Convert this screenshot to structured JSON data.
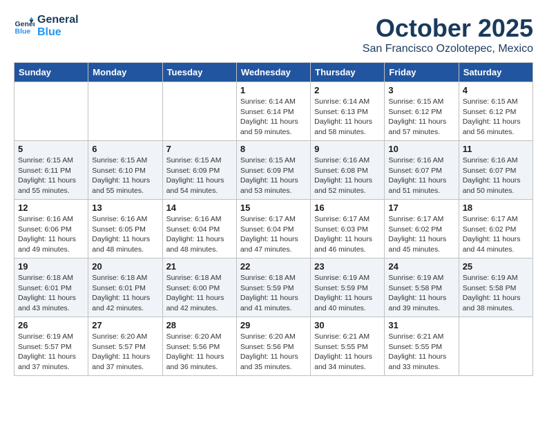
{
  "header": {
    "logo_line1": "General",
    "logo_line2": "Blue",
    "month": "October 2025",
    "location": "San Francisco Ozolotepec, Mexico"
  },
  "weekdays": [
    "Sunday",
    "Monday",
    "Tuesday",
    "Wednesday",
    "Thursday",
    "Friday",
    "Saturday"
  ],
  "weeks": [
    [
      {
        "day": "",
        "sunrise": "",
        "sunset": "",
        "daylight": ""
      },
      {
        "day": "",
        "sunrise": "",
        "sunset": "",
        "daylight": ""
      },
      {
        "day": "",
        "sunrise": "",
        "sunset": "",
        "daylight": ""
      },
      {
        "day": "1",
        "sunrise": "Sunrise: 6:14 AM",
        "sunset": "Sunset: 6:14 PM",
        "daylight": "Daylight: 11 hours and 59 minutes."
      },
      {
        "day": "2",
        "sunrise": "Sunrise: 6:14 AM",
        "sunset": "Sunset: 6:13 PM",
        "daylight": "Daylight: 11 hours and 58 minutes."
      },
      {
        "day": "3",
        "sunrise": "Sunrise: 6:15 AM",
        "sunset": "Sunset: 6:12 PM",
        "daylight": "Daylight: 11 hours and 57 minutes."
      },
      {
        "day": "4",
        "sunrise": "Sunrise: 6:15 AM",
        "sunset": "Sunset: 6:12 PM",
        "daylight": "Daylight: 11 hours and 56 minutes."
      }
    ],
    [
      {
        "day": "5",
        "sunrise": "Sunrise: 6:15 AM",
        "sunset": "Sunset: 6:11 PM",
        "daylight": "Daylight: 11 hours and 55 minutes."
      },
      {
        "day": "6",
        "sunrise": "Sunrise: 6:15 AM",
        "sunset": "Sunset: 6:10 PM",
        "daylight": "Daylight: 11 hours and 55 minutes."
      },
      {
        "day": "7",
        "sunrise": "Sunrise: 6:15 AM",
        "sunset": "Sunset: 6:09 PM",
        "daylight": "Daylight: 11 hours and 54 minutes."
      },
      {
        "day": "8",
        "sunrise": "Sunrise: 6:15 AM",
        "sunset": "Sunset: 6:09 PM",
        "daylight": "Daylight: 11 hours and 53 minutes."
      },
      {
        "day": "9",
        "sunrise": "Sunrise: 6:16 AM",
        "sunset": "Sunset: 6:08 PM",
        "daylight": "Daylight: 11 hours and 52 minutes."
      },
      {
        "day": "10",
        "sunrise": "Sunrise: 6:16 AM",
        "sunset": "Sunset: 6:07 PM",
        "daylight": "Daylight: 11 hours and 51 minutes."
      },
      {
        "day": "11",
        "sunrise": "Sunrise: 6:16 AM",
        "sunset": "Sunset: 6:07 PM",
        "daylight": "Daylight: 11 hours and 50 minutes."
      }
    ],
    [
      {
        "day": "12",
        "sunrise": "Sunrise: 6:16 AM",
        "sunset": "Sunset: 6:06 PM",
        "daylight": "Daylight: 11 hours and 49 minutes."
      },
      {
        "day": "13",
        "sunrise": "Sunrise: 6:16 AM",
        "sunset": "Sunset: 6:05 PM",
        "daylight": "Daylight: 11 hours and 48 minutes."
      },
      {
        "day": "14",
        "sunrise": "Sunrise: 6:16 AM",
        "sunset": "Sunset: 6:04 PM",
        "daylight": "Daylight: 11 hours and 48 minutes."
      },
      {
        "day": "15",
        "sunrise": "Sunrise: 6:17 AM",
        "sunset": "Sunset: 6:04 PM",
        "daylight": "Daylight: 11 hours and 47 minutes."
      },
      {
        "day": "16",
        "sunrise": "Sunrise: 6:17 AM",
        "sunset": "Sunset: 6:03 PM",
        "daylight": "Daylight: 11 hours and 46 minutes."
      },
      {
        "day": "17",
        "sunrise": "Sunrise: 6:17 AM",
        "sunset": "Sunset: 6:02 PM",
        "daylight": "Daylight: 11 hours and 45 minutes."
      },
      {
        "day": "18",
        "sunrise": "Sunrise: 6:17 AM",
        "sunset": "Sunset: 6:02 PM",
        "daylight": "Daylight: 11 hours and 44 minutes."
      }
    ],
    [
      {
        "day": "19",
        "sunrise": "Sunrise: 6:18 AM",
        "sunset": "Sunset: 6:01 PM",
        "daylight": "Daylight: 11 hours and 43 minutes."
      },
      {
        "day": "20",
        "sunrise": "Sunrise: 6:18 AM",
        "sunset": "Sunset: 6:01 PM",
        "daylight": "Daylight: 11 hours and 42 minutes."
      },
      {
        "day": "21",
        "sunrise": "Sunrise: 6:18 AM",
        "sunset": "Sunset: 6:00 PM",
        "daylight": "Daylight: 11 hours and 42 minutes."
      },
      {
        "day": "22",
        "sunrise": "Sunrise: 6:18 AM",
        "sunset": "Sunset: 5:59 PM",
        "daylight": "Daylight: 11 hours and 41 minutes."
      },
      {
        "day": "23",
        "sunrise": "Sunrise: 6:19 AM",
        "sunset": "Sunset: 5:59 PM",
        "daylight": "Daylight: 11 hours and 40 minutes."
      },
      {
        "day": "24",
        "sunrise": "Sunrise: 6:19 AM",
        "sunset": "Sunset: 5:58 PM",
        "daylight": "Daylight: 11 hours and 39 minutes."
      },
      {
        "day": "25",
        "sunrise": "Sunrise: 6:19 AM",
        "sunset": "Sunset: 5:58 PM",
        "daylight": "Daylight: 11 hours and 38 minutes."
      }
    ],
    [
      {
        "day": "26",
        "sunrise": "Sunrise: 6:19 AM",
        "sunset": "Sunset: 5:57 PM",
        "daylight": "Daylight: 11 hours and 37 minutes."
      },
      {
        "day": "27",
        "sunrise": "Sunrise: 6:20 AM",
        "sunset": "Sunset: 5:57 PM",
        "daylight": "Daylight: 11 hours and 37 minutes."
      },
      {
        "day": "28",
        "sunrise": "Sunrise: 6:20 AM",
        "sunset": "Sunset: 5:56 PM",
        "daylight": "Daylight: 11 hours and 36 minutes."
      },
      {
        "day": "29",
        "sunrise": "Sunrise: 6:20 AM",
        "sunset": "Sunset: 5:56 PM",
        "daylight": "Daylight: 11 hours and 35 minutes."
      },
      {
        "day": "30",
        "sunrise": "Sunrise: 6:21 AM",
        "sunset": "Sunset: 5:55 PM",
        "daylight": "Daylight: 11 hours and 34 minutes."
      },
      {
        "day": "31",
        "sunrise": "Sunrise: 6:21 AM",
        "sunset": "Sunset: 5:55 PM",
        "daylight": "Daylight: 11 hours and 33 minutes."
      },
      {
        "day": "",
        "sunrise": "",
        "sunset": "",
        "daylight": ""
      }
    ]
  ]
}
